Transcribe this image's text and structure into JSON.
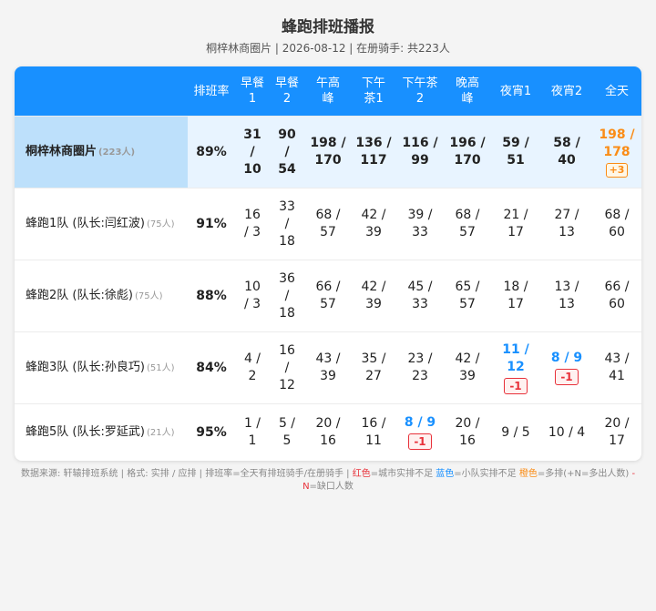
{
  "title": "蜂跑排班播报",
  "subtitle": "桐梓林商圈片 | 2026-08-12 | 在册骑手: 共223人",
  "headers": [
    "",
    "排班率",
    "早餐\n1",
    "早餐\n2",
    "午高\n峰",
    "下午\n茶1",
    "下午茶\n2",
    "晚高\n峰",
    "夜宵1",
    "夜宵2",
    "全天"
  ],
  "summary": {
    "name": "桐梓林商圈片",
    "count": "(223人)",
    "rate": "89%",
    "cells": [
      "31\n/\n10",
      "90\n/\n54",
      "198 /\n170",
      "136 /\n117",
      "116 /\n99",
      "196 /\n170",
      "59 /\n51",
      "58 /\n40",
      "198 /\n178"
    ],
    "total_badge": "+3"
  },
  "teams": [
    {
      "name": "蜂跑1队 (队长:闫红波)",
      "count": "(75人)",
      "rate": "91%",
      "cells": [
        "16\n/ 3",
        "33\n/\n18",
        "68 /\n57",
        "42 /\n39",
        "39 /\n33",
        "68 /\n57",
        "21 /\n17",
        "27 /\n13",
        "68 /\n60"
      ]
    },
    {
      "name": "蜂跑2队 (队长:徐彪)",
      "count": "(75人)",
      "rate": "88%",
      "cells": [
        "10\n/ 3",
        "36\n/\n18",
        "66 /\n57",
        "42 /\n39",
        "45 /\n33",
        "65 /\n57",
        "18 /\n17",
        "13 /\n13",
        "66 /\n60"
      ]
    },
    {
      "name": "蜂跑3队 (队长:孙良巧)",
      "count": "(51人)",
      "rate": "84%",
      "cells": [
        "4 /\n2",
        "16\n/\n12",
        "43 /\n39",
        "35 /\n27",
        "23 /\n23",
        "42 /\n39",
        "11 /\n12",
        "8 / 9",
        "43 /\n41"
      ],
      "badges": {
        "6": "-1",
        "7": "-1"
      }
    },
    {
      "name": "蜂跑5队 (队长:罗延武)",
      "count": "(21人)",
      "rate": "95%",
      "cells": [
        "1 /\n1",
        "5 /\n5",
        "20 /\n16",
        "16 /\n11",
        "8 / 9",
        "20 /\n16",
        "9 / 5",
        "10 / 4",
        "20 /\n17"
      ],
      "badges": {
        "4": "-1"
      }
    }
  ],
  "footer": {
    "main": "数据来源: 轩辕排班系统 | 格式: 实排 / 应排 | 排班率=全天有排班骑手/在册骑手 | ",
    "red_label": "红色",
    "red_desc": "=城市实排不足 ",
    "blue_label": "蓝色",
    "blue_desc": "=小队实排不足 ",
    "orange_label": "橙色",
    "orange_desc": "=多排(+N=多出人数) ",
    "minus_label": "-N",
    "minus_desc": "=缺口人数"
  },
  "colors": {
    "header_bg": "#1890ff",
    "summary_bg": "#e8f4ff",
    "summary_name_bg": "#bde0fb",
    "orange": "#fa8c16",
    "blue": "#1890ff",
    "red": "#e8313a"
  }
}
